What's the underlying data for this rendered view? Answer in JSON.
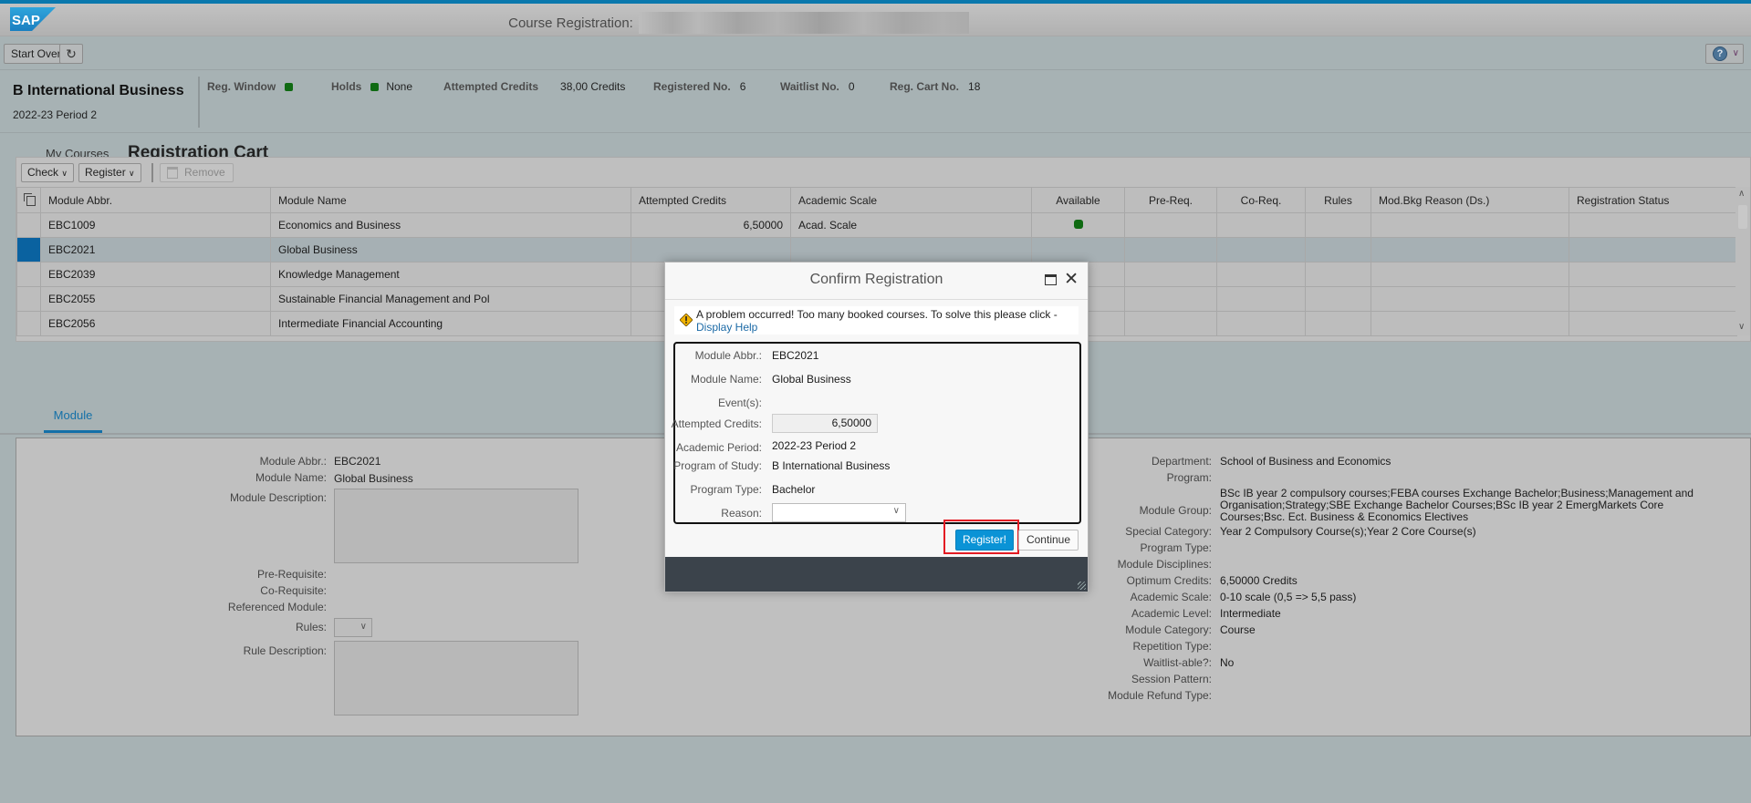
{
  "shell": {
    "logo": "SAP",
    "title_label": "Course Registration:",
    "title_value_redacted": true
  },
  "toolbar": {
    "start_over": "Start Over",
    "refresh_icon": "refresh-icon",
    "help_icon": "help-icon"
  },
  "header": {
    "program": "B International Business",
    "period": "2022-23 Period 2",
    "reg_window_label": "Reg. Window",
    "holds_label": "Holds",
    "holds_value": "None",
    "attempted_credits_label": "Attempted Credits",
    "attempted_credits_value": "38,00 Credits",
    "registered_label": "Registered No.",
    "registered_value": "6",
    "waitlist_label": "Waitlist No.",
    "waitlist_value": "0",
    "cart_label": "Reg. Cart No.",
    "cart_value": "18",
    "status_color": "#0f6a12"
  },
  "nav": {
    "my_courses": "My Courses",
    "registration_cart": "Registration Cart"
  },
  "table": {
    "toolbar": {
      "check": "Check",
      "register": "Register",
      "remove": "Remove"
    },
    "columns": [
      "Module Abbr.",
      "Module Name",
      "Attempted Credits",
      "Academic Scale",
      "Available",
      "Pre-Req.",
      "Co-Req.",
      "Rules",
      "Mod.Bkg Reason (Ds.)",
      "Registration Status"
    ],
    "rows": [
      {
        "abbr": "EBC1009",
        "name": "Economics and Business",
        "credits": "6,50000",
        "scale": "Acad. Scale",
        "available": true,
        "selected": false
      },
      {
        "abbr": "EBC2021",
        "name": "Global Business",
        "credits": "",
        "scale": "",
        "available": false,
        "selected": true
      },
      {
        "abbr": "EBC2039",
        "name": "Knowledge Management",
        "credits": "",
        "scale": "",
        "available": false,
        "selected": false
      },
      {
        "abbr": "EBC2055",
        "name": "Sustainable Financial Management and Pol",
        "credits": "",
        "scale": "",
        "available": false,
        "selected": false
      },
      {
        "abbr": "EBC2056",
        "name": "Intermediate Financial Accounting",
        "credits": "",
        "scale": "",
        "available": false,
        "selected": false
      }
    ]
  },
  "tabs": {
    "module": "Module"
  },
  "detail": {
    "left": {
      "module_abbr_label": "Module Abbr.:",
      "module_abbr": "EBC2021",
      "module_name_label": "Module Name:",
      "module_name": "Global Business",
      "module_description_label": "Module Description:",
      "pre_requisite_label": "Pre-Requisite:",
      "co_requisite_label": "Co-Requisite:",
      "referenced_module_label": "Referenced Module:",
      "rules_label": "Rules:",
      "rule_description_label": "Rule Description:"
    },
    "right": {
      "department_label": "Department:",
      "department": "School of Business and Economics",
      "program_label": "Program:",
      "module_group_label": "Module Group:",
      "module_group_line1": "BSc IB year 2 compulsory courses;FEBA courses Exchange Bachelor;Business;Management and",
      "module_group_line2": "Organisation;Strategy;SBE Exchange Bachelor Courses;BSc IB year 2 EmergMarkets Core",
      "module_group_line3": "Courses;Bsc. Ect. Business & Economics Electives",
      "special_category_label": "Special Category:",
      "special_category": "Year 2 Compulsory Course(s);Year 2 Core Course(s)",
      "program_type_label": "Program Type:",
      "module_disciplines_label": "Module Disciplines:",
      "optimum_credits_label": "Optimum Credits:",
      "optimum_credits": "6,50000 Credits",
      "academic_scale_label": "Academic Scale:",
      "academic_scale": "0-10 scale (0,5 => 5,5 pass)",
      "academic_level_label": "Academic Level:",
      "academic_level": "Intermediate",
      "module_category_label": "Module Category:",
      "module_category": "Course",
      "repetition_type_label": "Repetition Type:",
      "waitlistable_label": "Waitlist-able?:",
      "waitlistable": "No",
      "session_pattern_label": "Session Pattern:",
      "module_refund_type_label": "Module Refund Type:"
    }
  },
  "dialog": {
    "title": "Confirm Registration",
    "message": "A problem occurred! Too many booked courses. To solve this please click -",
    "help_link": "Display Help",
    "fields": {
      "module_abbr_label": "Module Abbr.:",
      "module_abbr": "EBC2021",
      "module_name_label": "Module Name:",
      "module_name": "Global Business",
      "events_label": "Event(s):",
      "attempted_credits_label": "Attempted Credits:",
      "attempted_credits": "6,50000",
      "academic_period_label": "Academic Period:",
      "academic_period": "2022-23 Period 2",
      "program_of_study_label": "Program of Study:",
      "program_of_study": "B International Business",
      "program_type_label": "Program Type:",
      "program_type": "Bachelor",
      "reason_label": "Reason:",
      "reason_value": ""
    },
    "register_button": "Register!",
    "continue_button": "Continue",
    "primary_color": "#0a93d6",
    "highlight_color": "#e31b23"
  }
}
